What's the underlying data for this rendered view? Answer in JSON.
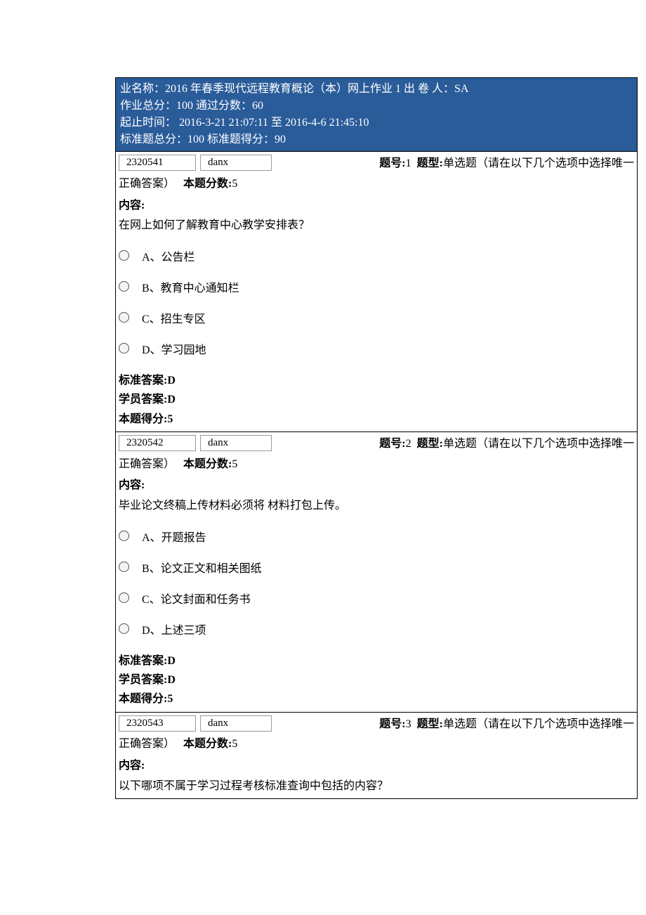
{
  "header": {
    "line1": "业名称：2016 年春季现代远程教育概论（本）网上作业 1  出 卷 人：SA",
    "line2": "作业总分：100  通过分数：60",
    "line3": "起止时间：   2016-3-21 21:07:11  至  2016-4-6 21:45:10",
    "line4": "标准题总分：100  标准题得分：90"
  },
  "questions": [
    {
      "id": "2320541",
      "type_code": "danx",
      "num_label": "题号:",
      "num": "1",
      "type_label": "题型:",
      "type_text": "单选题（请在以下几个选项中选择唯一",
      "cont_tail": "正确答案）",
      "score_label": "本题分数:",
      "score": "5",
      "content_label": "内容:",
      "content": "在网上如何了解教育中心教学安排表？",
      "options": [
        "A、公告栏",
        "B、教育中心通知栏",
        "C、招生专区",
        "D、学习园地"
      ],
      "std_ans_label": "标准答案:",
      "std_ans": "D",
      "stu_ans_label": "学员答案:",
      "stu_ans": "D",
      "got_label": "本题得分:",
      "got": "5"
    },
    {
      "id": "2320542",
      "type_code": "danx",
      "num_label": "题号:",
      "num": "2",
      "type_label": "题型:",
      "type_text": "单选题（请在以下几个选项中选择唯一",
      "cont_tail": "正确答案）",
      "score_label": "本题分数:",
      "score": "5",
      "content_label": "内容:",
      "content": "毕业论文终稿上传材料必须将 材料打包上传。",
      "options": [
        "A、开题报告",
        "B、论文正文和相关图纸",
        "C、论文封面和任务书",
        "D、上述三项"
      ],
      "std_ans_label": "标准答案:",
      "std_ans": "D",
      "stu_ans_label": "学员答案:",
      "stu_ans": "D",
      "got_label": "本题得分:",
      "got": "5"
    },
    {
      "id": "2320543",
      "type_code": "danx",
      "num_label": "题号:",
      "num": "3",
      "type_label": "题型:",
      "type_text": "单选题（请在以下几个选项中选择唯一",
      "cont_tail": "正确答案）",
      "score_label": "本题分数:",
      "score": "5",
      "content_label": "内容:",
      "content": "以下哪项不属于学习过程考核标准查询中包括的内容？"
    }
  ]
}
